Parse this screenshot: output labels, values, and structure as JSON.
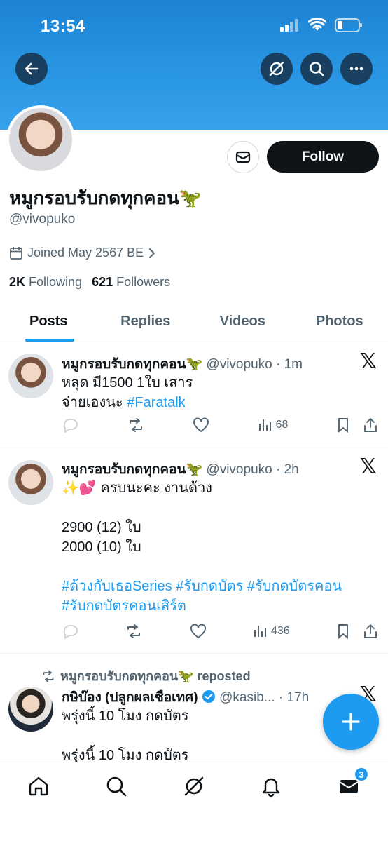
{
  "status_bar": {
    "time": "13:54"
  },
  "profile": {
    "display_name": "หมูกรอบรับกดทุกคอน🦖",
    "handle": "@vivopuko",
    "joined": "Joined May 2567 BE",
    "following_count": "2K",
    "following_label": "Following",
    "followers_count": "621",
    "followers_label": "Followers",
    "follow_label": "Follow"
  },
  "tabs": [
    {
      "label": "Posts",
      "active": true
    },
    {
      "label": "Replies"
    },
    {
      "label": "Videos"
    },
    {
      "label": "Photos"
    }
  ],
  "posts": [
    {
      "name": "หมูกรอบรับกดทุกคอน🦖",
      "handle": "@vivopuko",
      "time": "1m",
      "line1": "หลุด มี1500 1ใบ เสาร",
      "line2_text": "จ่ายเองนะ ",
      "line2_tag": "#Faratalk",
      "views": "68"
    },
    {
      "name": "หมูกรอบรับกดทุกคอน🦖",
      "handle": "@vivopuko",
      "time": "2h",
      "line1": "✨💕 ครบนะคะ งานด้วง",
      "line2": "2900 (12) ใบ",
      "line3": "2000 (10) ใบ",
      "tags_line1": "#ด้วงกับเธอSeries #รับกดบัตร #รับกดบัตรคอน",
      "tags_line2": "#รับกดบัตรคอนเสิร์ต",
      "views": "436"
    },
    {
      "repost_label": "หมูกรอบรับกดทุกคอน🦖 reposted",
      "name": "กษิบ๊อง (ปลูกผลเชือเทศ)",
      "handle": "@kasib...",
      "time": "17h",
      "line1": "พรุ่งนี้ 10 โมง กดบัตร",
      "line2": "พรุ่งนี้ 10 โมง กดบัตร"
    }
  ],
  "notifications_badge": "3",
  "colors": {
    "accent": "#1d9bf0",
    "banner": "#2a97e4",
    "text": "#0f1419",
    "muted": "#536471"
  }
}
